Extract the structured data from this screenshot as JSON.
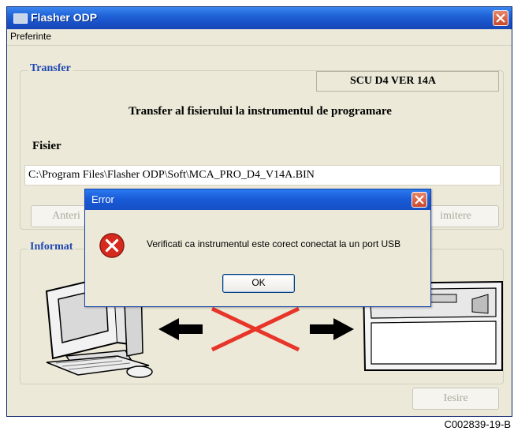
{
  "window": {
    "title": "Flasher ODP"
  },
  "menu": {
    "items": [
      "Preferinte"
    ]
  },
  "transfer": {
    "group_label": "Transfer",
    "version": "SCU D4 VER  14A",
    "heading": "Transfer al fisierului la instrumentul de programare",
    "file_label": "Fisier",
    "file_path": "C:\\Program Files\\Flasher ODP\\Soft\\MCA_PRO_D4_V14A.BIN",
    "prev_button": "Anteri",
    "send_button": "imitere"
  },
  "info": {
    "group_label": "Informat"
  },
  "exit_button": "Iesire",
  "error_dialog": {
    "title": "Error",
    "message": "Verificati ca instrumentul este corect conectat la un port USB",
    "ok_label": "OK"
  },
  "figure_code": "C002839-19-B",
  "colors": {
    "titlebar": "#1f62d6",
    "error_red": "#d62a1e",
    "arrow": "#000000",
    "cross": "#e8352a"
  }
}
